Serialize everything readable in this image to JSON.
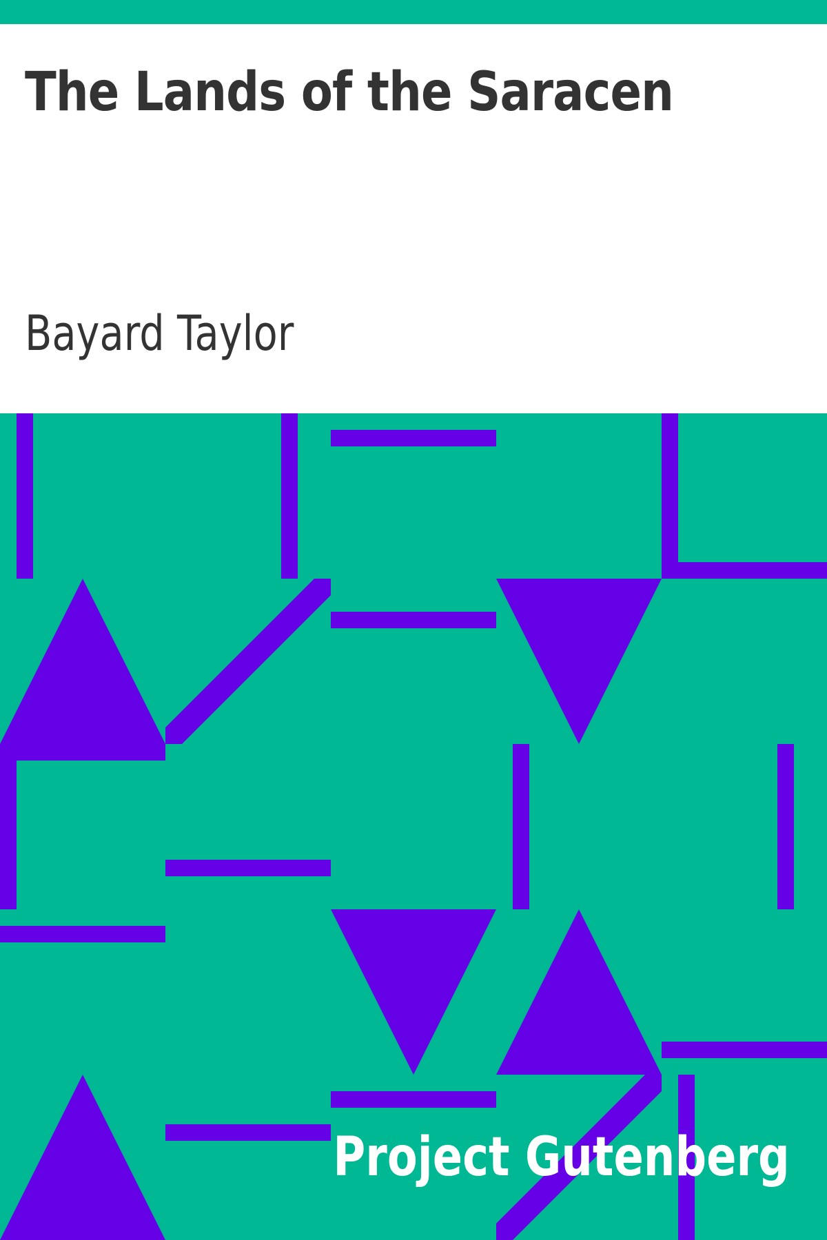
{
  "cover": {
    "title": "The Lands of the Saracen",
    "author": "Bayard Taylor",
    "publisher": "Project Gutenberg"
  },
  "colors": {
    "background": "#ffffff",
    "pattern_green": "#00b894",
    "pattern_purple": "#6600e6",
    "text_dark": "#333333",
    "text_light": "#ffffff"
  },
  "icons": {
    "pattern": "geometric-triangles-and-bars"
  }
}
